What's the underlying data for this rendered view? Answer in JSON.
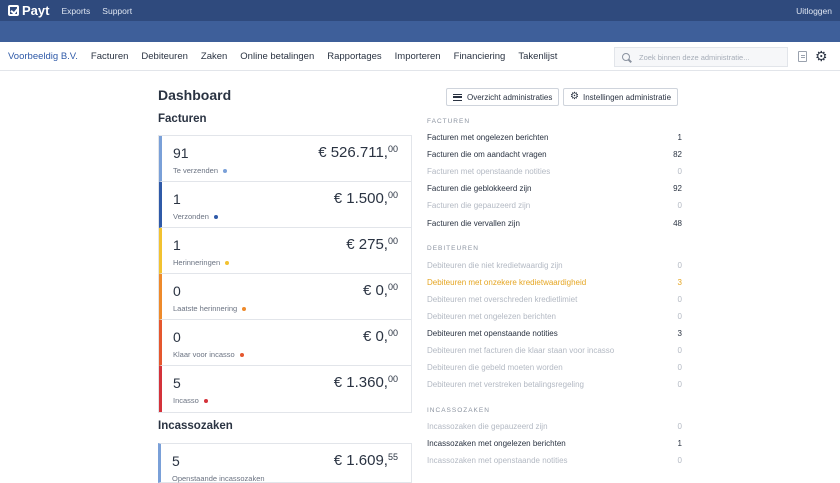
{
  "topbar": {
    "logo": "Payt",
    "links": [
      "Exports",
      "Support"
    ],
    "logout": "Uitloggen"
  },
  "nav": {
    "company": "Voorbeeldig B.V.",
    "items": [
      "Facturen",
      "Debiteuren",
      "Zaken",
      "Online betalingen",
      "Rapportages",
      "Importeren",
      "Financiering",
      "Takenlijst"
    ],
    "search_placeholder": "Zoek binnen deze administratie..."
  },
  "dashboard": {
    "title": "Dashboard",
    "buttons": {
      "overview": "Overzicht administraties",
      "settings": "Instellingen administratie"
    },
    "facturen_title": "Facturen",
    "cards": [
      {
        "count": "91",
        "label": "Te verzenden",
        "amount": "€ 526.711,",
        "cents": "00",
        "color": "#7aa0d8"
      },
      {
        "count": "1",
        "label": "Verzonden",
        "amount": "€ 1.500,",
        "cents": "00",
        "color": "#2f5aa8"
      },
      {
        "count": "1",
        "label": "Herinneringen",
        "amount": "€ 275,",
        "cents": "00",
        "color": "#f2c230"
      },
      {
        "count": "0",
        "label": "Laatste herinnering",
        "amount": "€ 0,",
        "cents": "00",
        "color": "#ee8a2b"
      },
      {
        "count": "0",
        "label": "Klaar voor incasso",
        "amount": "€ 0,",
        "cents": "00",
        "color": "#e5572e"
      },
      {
        "count": "5",
        "label": "Incasso",
        "amount": "€ 1.360,",
        "cents": "00",
        "color": "#d4323a"
      }
    ],
    "incasso_title": "Incassozaken",
    "incasso_card": {
      "count": "5",
      "label": "Openstaande incassozaken",
      "amount": "€ 1.609,",
      "cents": "55",
      "color": "#7aa0d8"
    }
  },
  "groups": [
    {
      "title": "FACTUREN",
      "rows": [
        {
          "label": "Facturen met ongelezen berichten",
          "count": "1",
          "state": "normal"
        },
        {
          "label": "Facturen die om aandacht vragen",
          "count": "82",
          "state": "normal"
        },
        {
          "label": "Facturen met openstaande notities",
          "count": "0",
          "state": "dim"
        },
        {
          "label": "Facturen die geblokkeerd zijn",
          "count": "92",
          "state": "normal"
        },
        {
          "label": "Facturen die gepauzeerd zijn",
          "count": "0",
          "state": "dim"
        },
        {
          "label": "Facturen die vervallen zijn",
          "count": "48",
          "state": "normal"
        }
      ]
    },
    {
      "title": "DEBITEUREN",
      "rows": [
        {
          "label": "Debiteuren die niet kredietwaardig zijn",
          "count": "0",
          "state": "dim"
        },
        {
          "label": "Debiteuren met onzekere kredietwaardigheid",
          "count": "3",
          "state": "warn"
        },
        {
          "label": "Debiteuren met overschreden kredietlimiet",
          "count": "0",
          "state": "dim"
        },
        {
          "label": "Debiteuren met ongelezen berichten",
          "count": "0",
          "state": "dim"
        },
        {
          "label": "Debiteuren met openstaande notities",
          "count": "3",
          "state": "normal"
        },
        {
          "label": "Debiteuren met facturen die klaar staan voor incasso",
          "count": "0",
          "state": "dim"
        },
        {
          "label": "Debiteuren die gebeld moeten worden",
          "count": "0",
          "state": "dim"
        },
        {
          "label": "Debiteuren met verstreken betalingsregeling",
          "count": "0",
          "state": "dim"
        }
      ]
    },
    {
      "title": "INCASSOZAKEN",
      "rows": [
        {
          "label": "Incassozaken die gepauzeerd zijn",
          "count": "0",
          "state": "dim"
        },
        {
          "label": "Incassozaken met ongelezen berichten",
          "count": "1",
          "state": "normal"
        },
        {
          "label": "Incassozaken met openstaande notities",
          "count": "0",
          "state": "dim"
        }
      ]
    }
  ]
}
